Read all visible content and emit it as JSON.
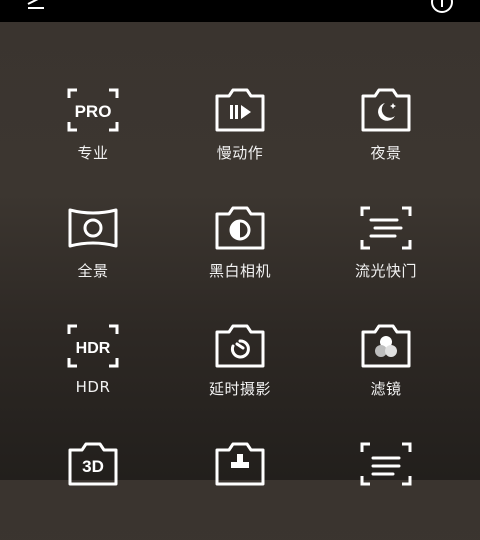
{
  "modes": [
    {
      "label": "专业",
      "icon": "pro-icon",
      "icon_text": "PRO"
    },
    {
      "label": "慢动作",
      "icon": "slow-motion-icon"
    },
    {
      "label": "夜景",
      "icon": "night-icon"
    },
    {
      "label": "全景",
      "icon": "panorama-icon"
    },
    {
      "label": "黑白相机",
      "icon": "monochrome-icon"
    },
    {
      "label": "流光快门",
      "icon": "light-painting-icon"
    },
    {
      "label": "HDR",
      "icon": "hdr-icon",
      "icon_text": "HDR"
    },
    {
      "label": "延时摄影",
      "icon": "time-lapse-icon"
    },
    {
      "label": "滤镜",
      "icon": "filter-icon"
    },
    {
      "label": "",
      "icon": "3d-icon",
      "icon_text": "3D"
    },
    {
      "label": "",
      "icon": "document-stamp-icon"
    },
    {
      "label": "",
      "icon": "document-scan-icon"
    }
  ]
}
